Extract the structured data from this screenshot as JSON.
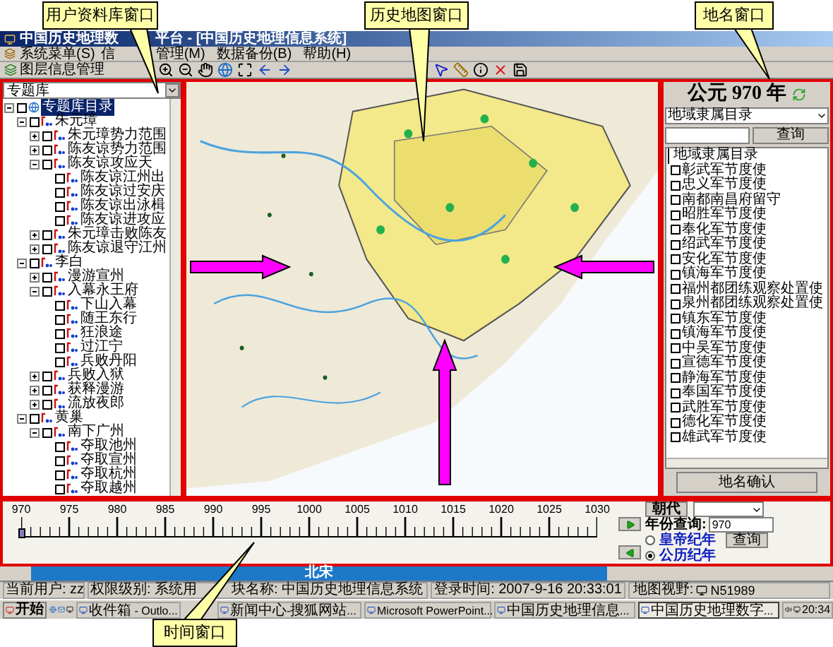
{
  "callouts": [
    "用户资料库窗口",
    "历史地图窗口",
    "地名窗口",
    "时间窗口"
  ],
  "window": {
    "title_parts": [
      "中国历史地理数",
      "平台 - [中国历史地理信息系统]"
    ]
  },
  "menu": [
    "系统菜单(S)",
    "信",
    "管理(M)",
    "数据备份(B)",
    "帮助(H)"
  ],
  "toolbar": {
    "layer_button": "图层信息管理"
  },
  "library": {
    "dropdown": "专题库",
    "tree": [
      {
        "label": "专题库目录",
        "kind": "root",
        "expanded": true,
        "checked": false,
        "selected": true,
        "children": [
          {
            "label": "朱元璋",
            "kind": "folder",
            "expanded": true,
            "checked": false,
            "selected": false,
            "children": [
              {
                "label": "朱元璋势力范围",
                "kind": "folder",
                "expanded": false,
                "checked": false,
                "selected": false
              },
              {
                "label": "陈友谅势力范围",
                "kind": "folder",
                "expanded": false,
                "checked": false,
                "selected": false
              },
              {
                "label": "陈友谅攻应天",
                "kind": "folder",
                "expanded": true,
                "checked": false,
                "selected": false,
                "children": [
                  {
                    "label": "陈友谅江州出",
                    "kind": "leaf",
                    "checked": false,
                    "selected": false
                  },
                  {
                    "label": "陈友谅过安庆",
                    "kind": "leaf",
                    "checked": false,
                    "selected": false
                  },
                  {
                    "label": "陈友谅出泳楫",
                    "kind": "leaf",
                    "checked": false,
                    "selected": false
                  },
                  {
                    "label": "陈友谅进攻应",
                    "kind": "leaf",
                    "checked": false,
                    "selected": false
                  }
                ]
              },
              {
                "label": "朱元璋击败陈友",
                "kind": "folder",
                "expanded": false,
                "checked": false,
                "selected": false
              },
              {
                "label": "陈友谅退守江州",
                "kind": "folder",
                "expanded": false,
                "checked": false,
                "selected": false
              }
            ]
          },
          {
            "label": "李白",
            "kind": "folder",
            "expanded": true,
            "checked": false,
            "selected": false,
            "children": [
              {
                "label": "漫游宣州",
                "kind": "folder",
                "expanded": false,
                "checked": false,
                "selected": false
              },
              {
                "label": "入幕永王府",
                "kind": "folder",
                "expanded": true,
                "checked": false,
                "selected": false,
                "children": [
                  {
                    "label": "下山入幕",
                    "kind": "leaf",
                    "checked": false,
                    "selected": false
                  },
                  {
                    "label": "随王东行",
                    "kind": "leaf",
                    "checked": false,
                    "selected": false
                  },
                  {
                    "label": "狂浪途",
                    "kind": "leaf",
                    "checked": false,
                    "selected": false
                  },
                  {
                    "label": "过江宁",
                    "kind": "leaf",
                    "checked": false,
                    "selected": false
                  },
                  {
                    "label": "兵败丹阳",
                    "kind": "leaf",
                    "checked": false,
                    "selected": false
                  }
                ]
              },
              {
                "label": "兵败入狱",
                "kind": "folder",
                "expanded": false,
                "checked": false,
                "selected": false
              },
              {
                "label": "获释漫游",
                "kind": "folder",
                "expanded": false,
                "checked": false,
                "selected": false
              },
              {
                "label": "流放夜郎",
                "kind": "folder",
                "expanded": false,
                "checked": false,
                "selected": false
              }
            ]
          },
          {
            "label": "黄巢",
            "kind": "folder",
            "expanded": true,
            "checked": false,
            "selected": false,
            "children": [
              {
                "label": "南下广州",
                "kind": "folder",
                "expanded": true,
                "checked": false,
                "selected": false,
                "children": [
                  {
                    "label": "夺取池州",
                    "kind": "leaf",
                    "checked": false,
                    "selected": false
                  },
                  {
                    "label": "夺取宣州",
                    "kind": "leaf",
                    "checked": false,
                    "selected": false
                  },
                  {
                    "label": "夺取杭州",
                    "kind": "leaf",
                    "checked": false,
                    "selected": false
                  },
                  {
                    "label": "夺取越州",
                    "kind": "leaf",
                    "checked": false,
                    "selected": false
                  }
                ]
              }
            ]
          }
        ]
      }
    ]
  },
  "places": {
    "year_title": "公元 970 年",
    "dropdown": "地域隶属目录",
    "search_button": "查询",
    "list_header": "地域隶属目录",
    "items": [
      {
        "label": "彰武军节度使",
        "checked": false
      },
      {
        "label": "忠义军节度使",
        "checked": false
      },
      {
        "label": "南都南昌府留守",
        "checked": false
      },
      {
        "label": "昭胜军节度使",
        "checked": false
      },
      {
        "label": "奉化军节度使",
        "checked": false
      },
      {
        "label": "绍武军节度使",
        "checked": false
      },
      {
        "label": "安化军节度使",
        "checked": false
      },
      {
        "label": "镇海军节度使",
        "checked": false
      },
      {
        "label": "福州都团练观察处置使",
        "checked": false
      },
      {
        "label": "泉州都团练观察处置使",
        "checked": false
      },
      {
        "label": "镇东军节度使",
        "checked": false
      },
      {
        "label": "镇海军节度使",
        "checked": false
      },
      {
        "label": "中吴军节度使",
        "checked": false
      },
      {
        "label": "宣德军节度使",
        "checked": false
      },
      {
        "label": "静海军节度使",
        "checked": false
      },
      {
        "label": "奉国军节度使",
        "checked": false
      },
      {
        "label": "武胜军节度使",
        "checked": false
      },
      {
        "label": "德化军节度使",
        "checked": false
      },
      {
        "label": "雄武军节度使",
        "checked": false
      }
    ],
    "confirm_button": "地名确认"
  },
  "timeline": {
    "years": [
      "970",
      "975",
      "980",
      "985",
      "990",
      "995",
      "1000",
      "1005",
      "1010",
      "1015",
      "1020",
      "1025",
      "1030"
    ],
    "slider": {
      "level": 0
    },
    "dynasty_button": "朝代",
    "year_label": "年份查询:",
    "year_value": "970",
    "calendars": [
      {
        "label": "皇帝纪年",
        "selected": false
      },
      {
        "label": "公历纪年",
        "selected": true
      }
    ],
    "search_button": "查询",
    "dynasty_bar": "北宋"
  },
  "status_bar": [
    "当前用户: zz",
    "权限级别: 系统用",
    "块名称: 中国历史地理信息系统",
    "登录时间: 2007-9-16 20:33:01",
    "地图视野:",
    "N51989"
  ],
  "taskbar": {
    "start": "开始",
    "tasks": [
      {
        "label": "收件箱 - Outlo...",
        "selected": false
      },
      {
        "label": "新闻中心-搜狐网站...",
        "selected": false
      },
      {
        "label": "Microsoft PowerPoint...",
        "selected": false
      },
      {
        "label": "中国历史地理信息...",
        "selected": false
      },
      {
        "label": "中国历史地理数字...",
        "selected": true
      }
    ],
    "clock": "20:34"
  }
}
